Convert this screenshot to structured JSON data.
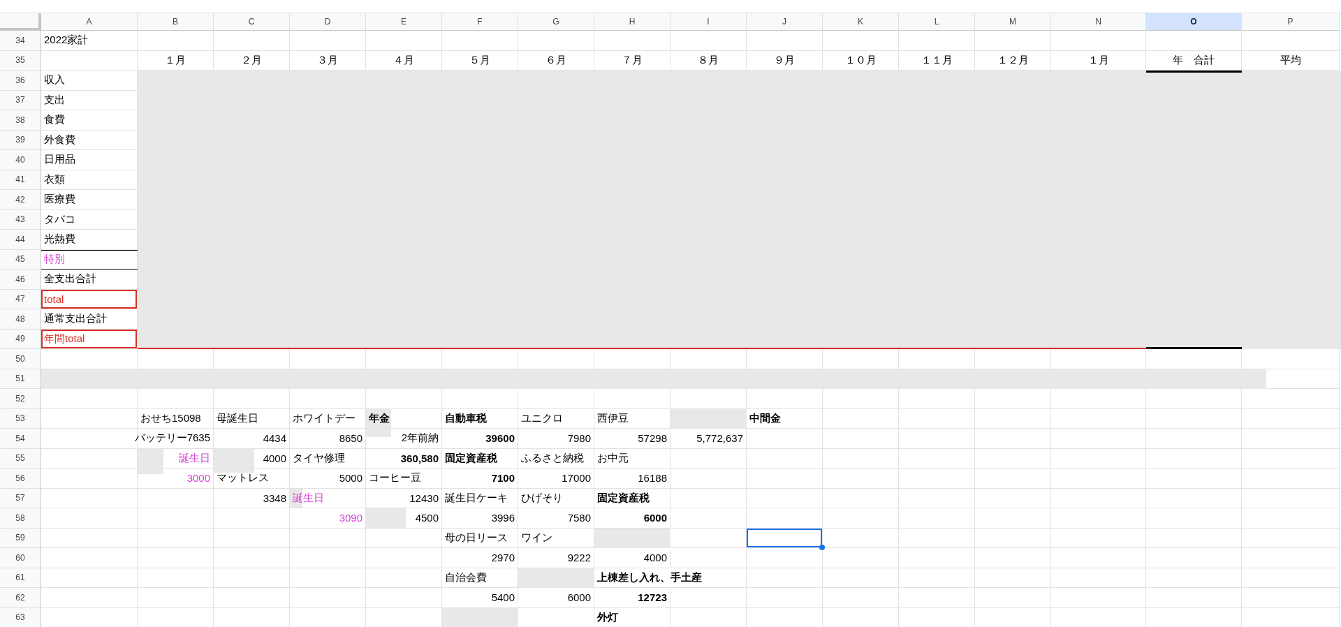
{
  "columns": [
    {
      "label": "A",
      "selected": false
    },
    {
      "label": "B",
      "selected": false
    },
    {
      "label": "C",
      "selected": false
    },
    {
      "label": "D",
      "selected": false
    },
    {
      "label": "E",
      "selected": false
    },
    {
      "label": "F",
      "selected": false
    },
    {
      "label": "G",
      "selected": false
    },
    {
      "label": "H",
      "selected": false
    },
    {
      "label": "I",
      "selected": false
    },
    {
      "label": "J",
      "selected": false
    },
    {
      "label": "K",
      "selected": false
    },
    {
      "label": "L",
      "selected": false
    },
    {
      "label": "M",
      "selected": false
    },
    {
      "label": "N",
      "selected": false
    },
    {
      "label": "O",
      "selected": true
    },
    {
      "label": "P",
      "selected": false
    }
  ],
  "rows": [
    {
      "number": "34",
      "cells": [
        {
          "kind": "text",
          "text": "2022家計"
        }
      ]
    },
    {
      "number": "35",
      "cells": [
        null,
        {
          "kind": "header",
          "text": "１月"
        },
        {
          "kind": "header",
          "text": "２月"
        },
        {
          "kind": "header",
          "text": "３月"
        },
        {
          "kind": "header",
          "text": "４月"
        },
        {
          "kind": "header",
          "text": "５月"
        },
        {
          "kind": "header",
          "text": "６月"
        },
        {
          "kind": "header",
          "text": "７月"
        },
        {
          "kind": "header",
          "text": "８月"
        },
        {
          "kind": "header",
          "text": "９月"
        },
        {
          "kind": "header",
          "text": "１０月"
        },
        {
          "kind": "header",
          "text": "１１月"
        },
        {
          "kind": "header",
          "text": "１２月"
        },
        {
          "kind": "header",
          "text": "１月"
        },
        {
          "kind": "header",
          "text": "年　合計"
        },
        {
          "kind": "header",
          "text": "平均"
        }
      ]
    },
    {
      "number": "36",
      "cells": [
        {
          "kind": "text",
          "text": "収入"
        }
      ]
    },
    {
      "number": "37",
      "cells": [
        {
          "kind": "text",
          "text": "支出"
        }
      ]
    },
    {
      "number": "38",
      "cells": [
        {
          "kind": "text",
          "text": "食費"
        }
      ]
    },
    {
      "number": "39",
      "cells": [
        {
          "kind": "text",
          "text": "外食費"
        }
      ]
    },
    {
      "number": "40",
      "cells": [
        {
          "kind": "text",
          "text": "日用品"
        }
      ]
    },
    {
      "number": "41",
      "cells": [
        {
          "kind": "text",
          "text": "衣類"
        }
      ]
    },
    {
      "number": "42",
      "cells": [
        {
          "kind": "text",
          "text": "医療費"
        }
      ]
    },
    {
      "number": "43",
      "cells": [
        {
          "kind": "text",
          "text": "タバコ"
        }
      ]
    },
    {
      "number": "44",
      "cells": [
        {
          "kind": "text",
          "text": "光熱費"
        }
      ]
    },
    {
      "number": "45",
      "cells": [
        {
          "kind": "text",
          "text": "特別",
          "color": "#d63fd6"
        }
      ]
    },
    {
      "number": "46",
      "cells": [
        {
          "kind": "text",
          "text": "全支出合計"
        }
      ]
    },
    {
      "number": "47",
      "cells": [
        {
          "kind": "text",
          "text": "total",
          "color": "#d93025",
          "outlined": true
        }
      ]
    },
    {
      "number": "48",
      "cells": [
        {
          "kind": "text",
          "text": "通常支出合計"
        }
      ]
    },
    {
      "number": "49",
      "cells": [
        {
          "kind": "text",
          "text": "年間total",
          "color": "#d93025",
          "outlined": true
        }
      ]
    },
    {
      "number": "50",
      "cells": []
    },
    {
      "number": "51",
      "cells": []
    },
    {
      "number": "52",
      "cells": []
    },
    {
      "number": "53",
      "cells": [
        null,
        {
          "kind": "text",
          "text": "おせち15098"
        },
        {
          "kind": "text",
          "text": "母誕生日"
        },
        {
          "kind": "text",
          "text": "ホワイトデー"
        },
        {
          "kind": "text",
          "text": "年金",
          "bold": true
        },
        {
          "kind": "text",
          "text": "自動車税",
          "bold": true
        },
        {
          "kind": "text",
          "text": "ユニクロ"
        },
        {
          "kind": "text",
          "text": "西伊豆"
        },
        null,
        {
          "kind": "text",
          "text": "中間金",
          "bold": true
        }
      ]
    },
    {
      "number": "54",
      "cells": [
        null,
        {
          "kind": "number",
          "text": "バッテリー7635"
        },
        {
          "kind": "number",
          "text": "4434"
        },
        {
          "kind": "number",
          "text": "8650"
        },
        {
          "kind": "number",
          "text": "2年前納"
        },
        {
          "kind": "number",
          "text": "39600",
          "bold": true
        },
        {
          "kind": "number",
          "text": "7980"
        },
        {
          "kind": "number",
          "text": "57298"
        },
        {
          "kind": "number",
          "text": "5,772,637"
        }
      ]
    },
    {
      "number": "55",
      "cells": [
        null,
        {
          "kind": "number",
          "text": "誕生日",
          "color": "#d63fd6"
        },
        {
          "kind": "number",
          "text": "4000"
        },
        {
          "kind": "text",
          "text": "タイヤ修理"
        },
        {
          "kind": "number",
          "text": "360,580",
          "bold": true
        },
        {
          "kind": "text",
          "text": "固定資産税",
          "bold": true
        },
        {
          "kind": "text",
          "text": "ふるさと納税"
        },
        {
          "kind": "text",
          "text": "お中元"
        }
      ]
    },
    {
      "number": "56",
      "cells": [
        null,
        {
          "kind": "number",
          "text": "3000",
          "color": "#d63fd6"
        },
        {
          "kind": "text",
          "text": "マットレス"
        },
        {
          "kind": "number",
          "text": "5000"
        },
        {
          "kind": "text",
          "text": "コーヒー豆"
        },
        {
          "kind": "number",
          "text": "7100",
          "bold": true
        },
        {
          "kind": "number",
          "text": "17000"
        },
        {
          "kind": "number",
          "text": "16188"
        }
      ]
    },
    {
      "number": "57",
      "cells": [
        null,
        null,
        {
          "kind": "number",
          "text": "3348"
        },
        {
          "kind": "text",
          "text": "誕生日",
          "color": "#d63fd6"
        },
        {
          "kind": "number",
          "text": "12430"
        },
        {
          "kind": "text",
          "text": "誕生日ケーキ"
        },
        {
          "kind": "text",
          "text": "ひげそり"
        },
        {
          "kind": "text",
          "text": "固定資産税",
          "bold": true
        }
      ]
    },
    {
      "number": "58",
      "cells": [
        null,
        null,
        null,
        {
          "kind": "number",
          "text": "3090",
          "color": "#d63fd6"
        },
        {
          "kind": "number",
          "text": "4500"
        },
        {
          "kind": "number",
          "text": "3996"
        },
        {
          "kind": "number",
          "text": "7580"
        },
        {
          "kind": "number",
          "text": "6000",
          "bold": true
        }
      ]
    },
    {
      "number": "59",
      "cells": [
        null,
        null,
        null,
        null,
        null,
        {
          "kind": "text",
          "text": "母の日リース"
        },
        {
          "kind": "text",
          "text": "ワイン"
        },
        null,
        null,
        {
          "kind": "empty",
          "selected": true
        }
      ]
    },
    {
      "number": "60",
      "cells": [
        null,
        null,
        null,
        null,
        null,
        {
          "kind": "number",
          "text": "2970"
        },
        {
          "kind": "number",
          "text": "9222"
        },
        {
          "kind": "number",
          "text": "4000"
        }
      ]
    },
    {
      "number": "61",
      "cells": [
        null,
        null,
        null,
        null,
        null,
        {
          "kind": "text",
          "text": "自治会費"
        },
        null,
        {
          "kind": "text",
          "text": "上棟差し入れ、手土産",
          "bold": true
        }
      ]
    },
    {
      "number": "62",
      "cells": [
        null,
        null,
        null,
        null,
        null,
        {
          "kind": "number",
          "text": "5400"
        },
        {
          "kind": "number",
          "text": "6000"
        },
        {
          "kind": "number",
          "text": "12723",
          "bold": true
        }
      ]
    },
    {
      "number": "63",
      "cells": [
        null,
        null,
        null,
        null,
        null,
        null,
        null,
        {
          "kind": "text",
          "text": "外灯",
          "bold": true
        }
      ]
    }
  ]
}
